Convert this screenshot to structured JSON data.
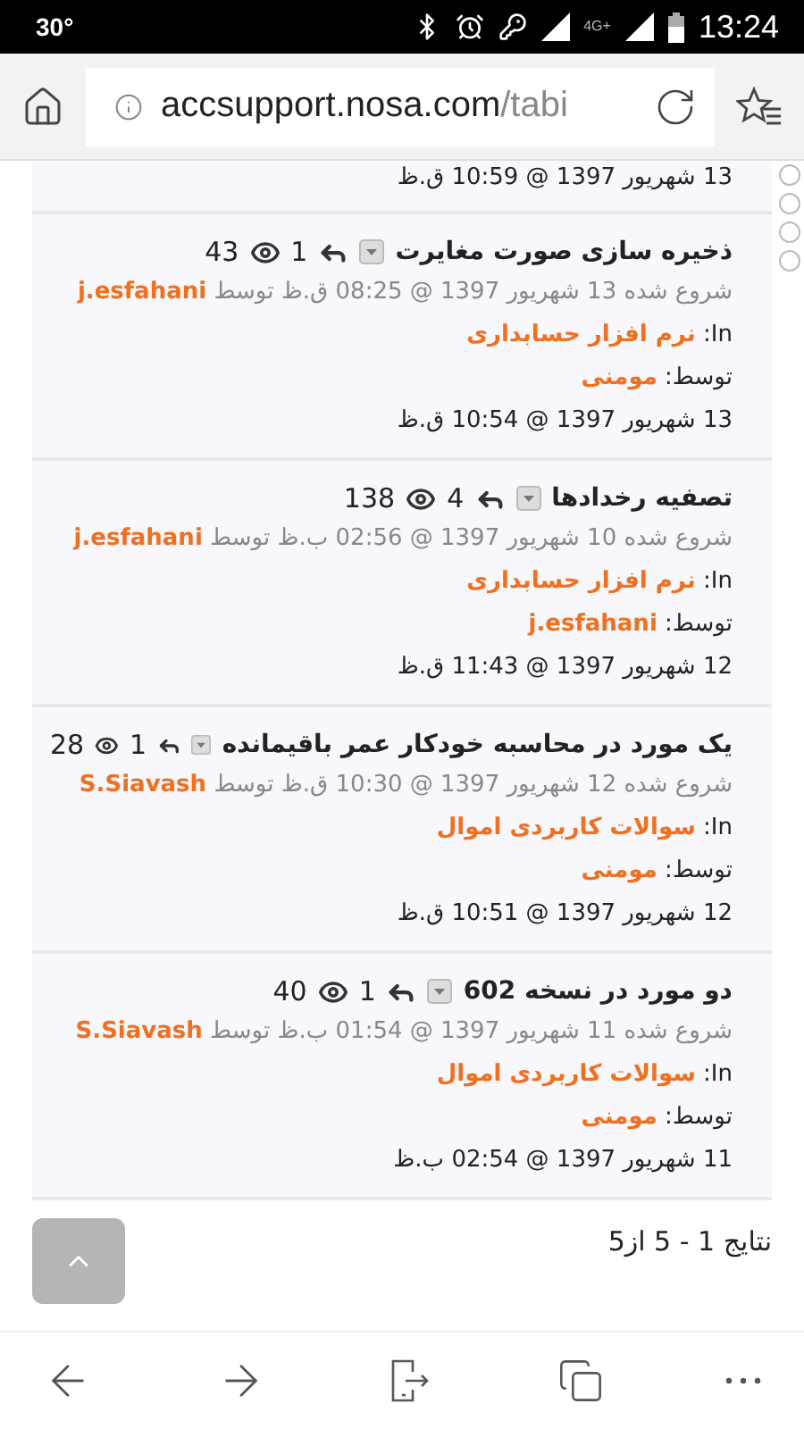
{
  "status_bar": {
    "temperature": "30°",
    "network": "4G+",
    "time": "13:24"
  },
  "browser": {
    "url_host": "accsupport.nosa.com",
    "url_path": "/tabi"
  },
  "partial_topic": {
    "last_post": "13 شهریور 1397 @ 10:59 ق.ظ"
  },
  "topics": [
    {
      "title": "ذخیره سازی صورت مغایرت",
      "replies": "1",
      "views": "43",
      "started": "شروع شده 13 شهریور 1397 @ 08:25 ق.ظ توسط",
      "author": "j.esfahani",
      "in_label": "In:",
      "forum": "نرم افزار حسابداری",
      "by_label": "توسط:",
      "last_poster": "مومنی",
      "last_post": "13 شهریور 1397 @ 10:54 ق.ظ"
    },
    {
      "title": "تصفیه رخدادها",
      "replies": "4",
      "views": "138",
      "started": "شروع شده 10 شهریور 1397 @ 02:56 ب.ظ توسط",
      "author": "j.esfahani",
      "in_label": "In:",
      "forum": "نرم افزار حسابداری",
      "by_label": "توسط:",
      "last_poster": "j.esfahani",
      "last_post": "12 شهریور 1397 @ 11:43 ق.ظ"
    },
    {
      "title": "یک مورد در محاسبه خودکار عمر باقیمانده",
      "replies": "1",
      "views": "28",
      "started": "شروع شده 12 شهریور 1397 @ 10:30 ق.ظ توسط",
      "author": "S.Siavash",
      "in_label": "In:",
      "forum": "سوالات کاربردی اموال",
      "by_label": "توسط:",
      "last_poster": "مومنی",
      "last_post": "12 شهریور 1397 @ 10:51 ق.ظ"
    },
    {
      "title": "دو مورد در نسخه 602",
      "replies": "1",
      "views": "40",
      "started": "شروع شده 11 شهریور 1397 @ 01:54 ب.ظ توسط",
      "author": "S.Siavash",
      "in_label": "In:",
      "forum": "سوالات کاربردی اموال",
      "by_label": "توسط:",
      "last_poster": "مومنی",
      "last_post": "11 شهریور 1397 @ 02:54 ب.ظ"
    }
  ],
  "results": "نتایج 1 - 5 از5"
}
